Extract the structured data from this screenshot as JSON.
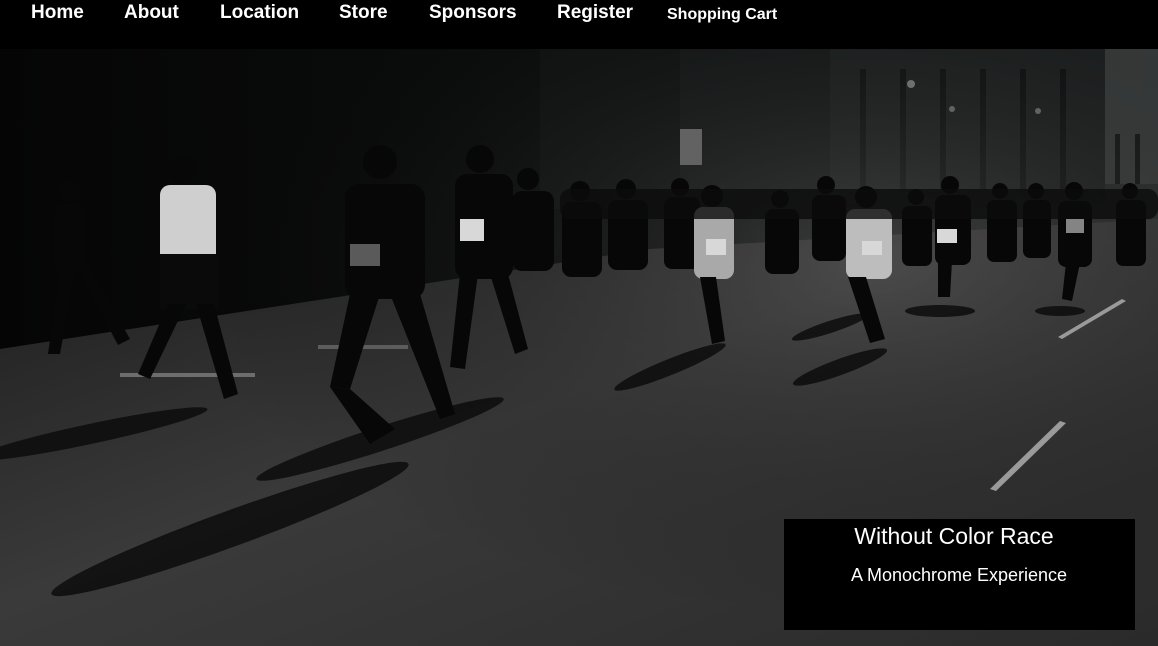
{
  "nav": {
    "home": "Home",
    "about": "About",
    "location": "Location",
    "store": "Store",
    "sponsors": "Sponsors",
    "register": "Register",
    "cart": "Shopping Cart"
  },
  "hero": {
    "image_icon": "runners-photo",
    "title": "Without Color Race",
    "subtitle": "A Monochrome Experience"
  },
  "colors": {
    "nav_bg": "#000000",
    "nav_text": "#ffffff",
    "caption_bg": "#000000"
  }
}
